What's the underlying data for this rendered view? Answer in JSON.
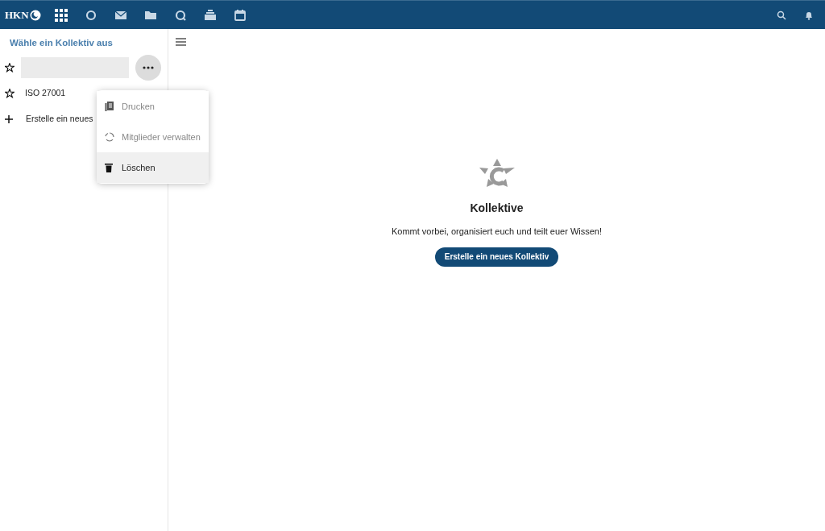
{
  "header": {
    "logo": "HKN",
    "apps": [
      {
        "kind": "grid"
      },
      {
        "kind": "circle"
      },
      {
        "kind": "mail"
      },
      {
        "kind": "folder"
      },
      {
        "kind": "talk"
      },
      {
        "kind": "deck"
      },
      {
        "kind": "calendar"
      }
    ]
  },
  "sidebar": {
    "title": "Wähle ein Kollektiv aus",
    "items": [
      {
        "kind": "rename"
      },
      {
        "kind": "collective",
        "label": "ISO 27001"
      },
      {
        "kind": "new",
        "label": "Erstelle ein neues"
      }
    ]
  },
  "menu": {
    "items": [
      {
        "kind": "print",
        "label": "Drucken",
        "disabled": true,
        "selected": false
      },
      {
        "kind": "members",
        "label": "Mitglieder verwalten",
        "disabled": true,
        "selected": false
      },
      {
        "kind": "trash",
        "label": "Löschen",
        "disabled": false,
        "selected": true
      }
    ]
  },
  "empty": {
    "title": "Kollektive",
    "text": "Kommt vorbei, organisiert euch und teilt euer Wissen!",
    "button": "Erstelle ein neues Kollektiv"
  }
}
